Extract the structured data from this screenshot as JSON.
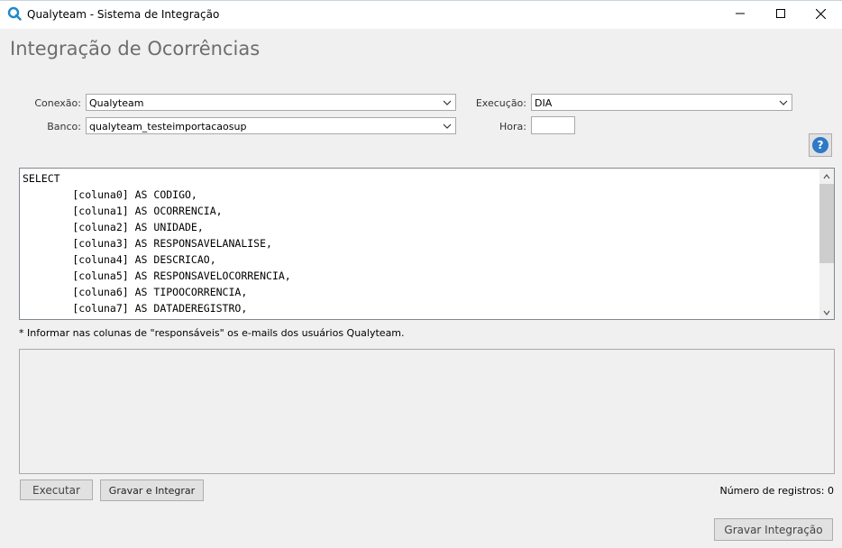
{
  "window": {
    "title": "Qualyteam - Sistema de Integração",
    "icon": "qualyteam-logo-icon",
    "controls": [
      "minimize-icon",
      "maximize-icon",
      "close-icon"
    ]
  },
  "page": {
    "heading": "Integração de Ocorrências"
  },
  "form": {
    "conexao_label": "Conexão:",
    "conexao_value": "Qualyteam",
    "banco_label": "Banco:",
    "banco_value": "qualyteam_testeimportacaosup",
    "execucao_label": "Execução:",
    "execucao_value": "DIA",
    "hora_label": "Hora:",
    "hora_value": ""
  },
  "help": {
    "icon": "help-icon",
    "glyph": "?"
  },
  "sql": {
    "lines": [
      "SELECT",
      "        [coluna0] AS CODIGO,",
      "        [coluna1] AS OCORRENCIA,",
      "        [coluna2] AS UNIDADE,",
      "        [coluna3] AS RESPONSAVELANALISE,",
      "        [coluna4] AS DESCRICAO,",
      "        [coluna5] AS RESPONSAVELOCORRENCIA,",
      "        [coluna6] AS TIPOOCORRENCIA,",
      "        [coluna7] AS DATADEREGISTRO,"
    ]
  },
  "note": "* Informar nas colunas de \"responsáveis\" os e-mails dos usuários Qualyteam.",
  "actions": {
    "executar": "Executar",
    "gravar_integrar": "Gravar e Integrar",
    "gravar_integracao": "Gravar Integração",
    "record_count": "Número de registros: 0"
  },
  "colors": {
    "heading": "#6d6d6d",
    "help_accent": "#2e79c8",
    "brand": "#1e88c9"
  }
}
